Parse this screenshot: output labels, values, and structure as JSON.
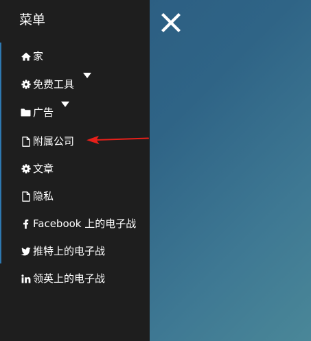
{
  "menu": {
    "title": "菜单",
    "items": [
      {
        "label": "家",
        "icon": "home-icon"
      },
      {
        "label": "免费工具",
        "icon": "gear-icon",
        "has_dropdown": true
      },
      {
        "label": "广告",
        "icon": "folder-icon",
        "has_dropdown": true
      },
      {
        "label": "附属公司",
        "icon": "file-icon"
      },
      {
        "label": "文章",
        "icon": "gear-icon"
      },
      {
        "label": "隐私",
        "icon": "file-icon"
      },
      {
        "label": "Facebook 上的电子战",
        "icon": "facebook-icon"
      },
      {
        "label": "推特上的电子战",
        "icon": "twitter-icon"
      },
      {
        "label": "领英上的电子战",
        "icon": "linkedin-icon"
      }
    ]
  },
  "close_icon": "close-icon",
  "colors": {
    "panel": "#1e1e1e",
    "accent": "#2e78b0",
    "annotation_arrow": "#e8201a"
  }
}
